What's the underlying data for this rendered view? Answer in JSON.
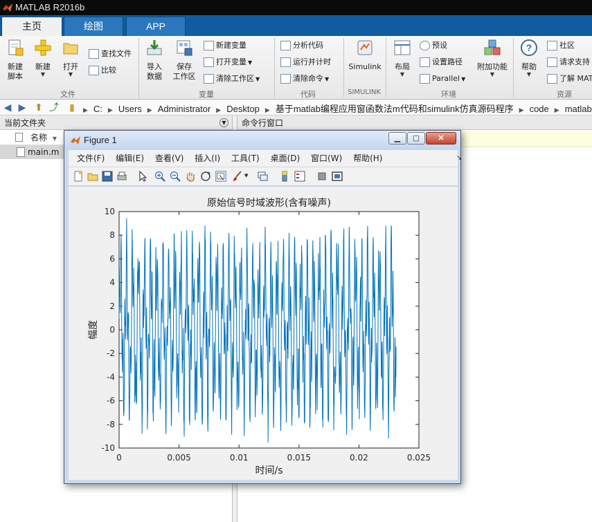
{
  "app": {
    "title": "MATLAB R2016b"
  },
  "tabs": [
    {
      "label": "主页",
      "active": true
    },
    {
      "label": "绘图",
      "active": false
    },
    {
      "label": "APP",
      "active": false
    }
  ],
  "ribbon": {
    "new_script": "新建\n脚本",
    "new": "新建",
    "open": "打开",
    "find_files": "查找文件",
    "compare": "比较",
    "import_data": "导入\n数据",
    "save_workspace": "保存\n工作区",
    "new_variable": "新建变量",
    "open_variable": "打开变量",
    "clear_workspace": "清除工作区",
    "analyze_code": "分析代码",
    "run_and_time": "运行并计时",
    "clear_commands": "清除命令",
    "simulink": "Simulink",
    "layout": "布局",
    "preferences": "预设",
    "set_path": "设置路径",
    "parallel": "Parallel",
    "add_ons": "附加功能",
    "help": "帮助",
    "community": "社区",
    "request_support": "请求支持",
    "learn_matlab": "了解 MATLAB",
    "groups": {
      "file": "文件",
      "variable": "变量",
      "code": "代码",
      "simulink": "SIMULINK",
      "environment": "环境",
      "resources": "资源"
    }
  },
  "address": {
    "crumbs": [
      "C:",
      "Users",
      "Administrator",
      "Desktop",
      "基于matlab编程应用窗函数法m代码和simulink仿真源码程序",
      "code",
      "matlab"
    ]
  },
  "left_panel": {
    "title": "当前文件夹",
    "column_name": "名称",
    "files": [
      "main.m"
    ]
  },
  "right_panel": {
    "title": "命令行窗口"
  },
  "figure": {
    "title": "Figure 1",
    "menu": [
      "文件(F)",
      "编辑(E)",
      "查看(V)",
      "插入(I)",
      "工具(T)",
      "桌面(D)",
      "窗口(W)",
      "帮助(H)"
    ]
  },
  "chart_data": {
    "type": "line",
    "title": "原始信号时域波形(含有噪声)",
    "xlabel": "时间/s",
    "ylabel": "幅度",
    "xlim": [
      0,
      0.025
    ],
    "ylim": [
      -10,
      10
    ],
    "x_ticks": [
      "0",
      "0.005",
      "0.01",
      "0.015",
      "0.02",
      "0.025"
    ],
    "y_ticks": [
      "-10",
      "-8",
      "-6",
      "-4",
      "-2",
      "0",
      "2",
      "4",
      "6",
      "8",
      "10"
    ],
    "series": [
      {
        "color": "#0072bd",
        "x_start": 0,
        "x_end": 0.0231,
        "y_min": -9.6,
        "y_max": 9.6,
        "cycles_visible": 46
      }
    ],
    "grid": false
  },
  "colors": {
    "tab_bar": "#0f5ca0",
    "line": "#0072bd",
    "figure_frame": "#c8daf0"
  }
}
